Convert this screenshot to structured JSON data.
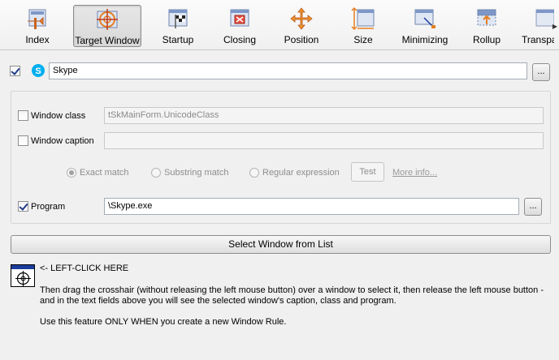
{
  "toolbar": {
    "items": [
      {
        "label": "Index",
        "icon": "index-icon"
      },
      {
        "label": "Target Window",
        "icon": "crosshair-icon",
        "active": true
      },
      {
        "label": "Startup",
        "icon": "startup-flag-icon"
      },
      {
        "label": "Closing",
        "icon": "closing-icon"
      },
      {
        "label": "Position",
        "icon": "position-arrows-icon"
      },
      {
        "label": "Size",
        "icon": "size-icon"
      },
      {
        "label": "Minimizing",
        "icon": "minimizing-icon"
      },
      {
        "label": "Rollup",
        "icon": "rollup-icon"
      },
      {
        "label": "Transpa",
        "icon": "transparency-icon"
      }
    ]
  },
  "rule": {
    "enabled": true,
    "name": "Skype",
    "browse_label": "..."
  },
  "criteria": {
    "window_class": {
      "label": "Window class",
      "checked": false,
      "value": "tSkMainForm.UnicodeClass"
    },
    "window_caption": {
      "label": "Window caption",
      "checked": false,
      "value": ""
    },
    "match": {
      "exact": "Exact match",
      "substring": "Substring match",
      "regex": "Regular expression",
      "selected": "exact"
    },
    "test_label": "Test",
    "more_info": "More info...",
    "program": {
      "label": "Program",
      "checked": true,
      "value": "\\Skype.exe",
      "browse_label": "..."
    }
  },
  "select_from_list_label": "Select Window from List",
  "finder": {
    "click_here": "<- LEFT-CLICK HERE",
    "instructions": "Then drag the crosshair (without releasing the left mouse button) over a window to select it, then release the left mouse button - and in the text fields above you will see the selected window's caption, class and program.",
    "note": "Use this feature ONLY WHEN you create a new Window Rule."
  },
  "colors": {
    "accent_blue": "#1c3c9c",
    "skype_blue": "#00aff0",
    "icon_orange": "#e67e22"
  }
}
